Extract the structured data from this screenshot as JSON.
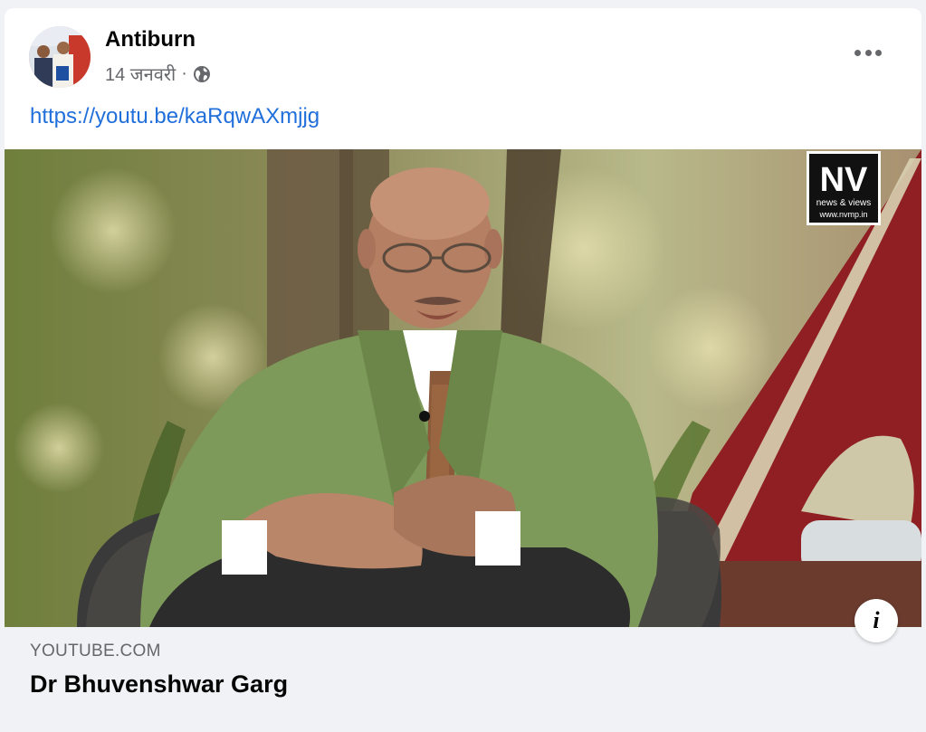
{
  "post": {
    "author": "Antiburn",
    "date": "14 जनवरी",
    "separator": "·",
    "privacy_icon": "globe-icon",
    "more_icon": "more-horizontal-icon",
    "link_text": "https://youtu.be/kaRqwAXmjjg"
  },
  "preview": {
    "domain": "YOUTUBE.COM",
    "title": "Dr Bhuvenshwar Garg",
    "info_label": "i",
    "watermark": {
      "main": "NV",
      "line1": "news & views",
      "line2": "www.nvmp.in"
    }
  },
  "colors": {
    "link": "#216fdb",
    "secondary_text": "#65676b",
    "footer_bg": "#f0f2f5",
    "page_bg": "#f0f2f5"
  }
}
